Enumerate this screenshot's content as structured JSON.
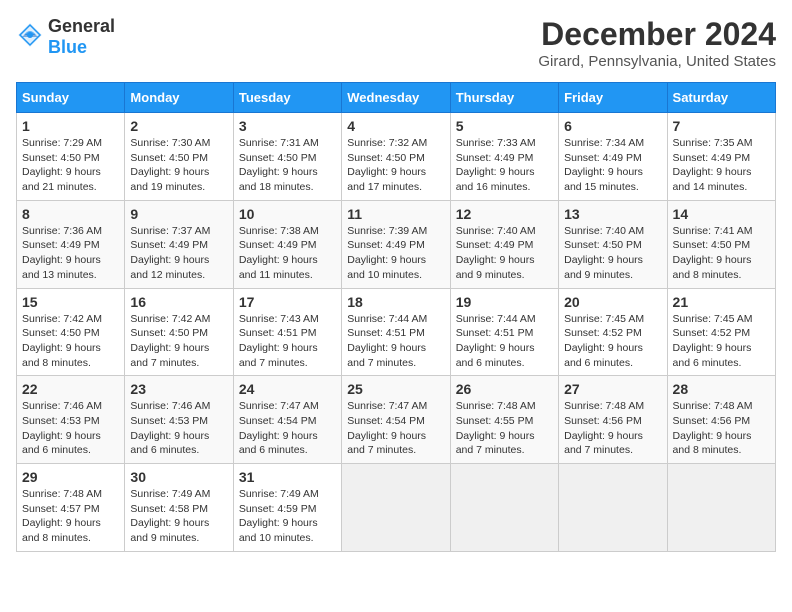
{
  "header": {
    "logo_general": "General",
    "logo_blue": "Blue",
    "title": "December 2024",
    "location": "Girard, Pennsylvania, United States"
  },
  "calendar": {
    "days_of_week": [
      "Sunday",
      "Monday",
      "Tuesday",
      "Wednesday",
      "Thursday",
      "Friday",
      "Saturday"
    ],
    "weeks": [
      [
        {
          "day": "1",
          "sunrise": "7:29 AM",
          "sunset": "4:50 PM",
          "daylight": "9 hours and 21 minutes."
        },
        {
          "day": "2",
          "sunrise": "7:30 AM",
          "sunset": "4:50 PM",
          "daylight": "9 hours and 19 minutes."
        },
        {
          "day": "3",
          "sunrise": "7:31 AM",
          "sunset": "4:50 PM",
          "daylight": "9 hours and 18 minutes."
        },
        {
          "day": "4",
          "sunrise": "7:32 AM",
          "sunset": "4:50 PM",
          "daylight": "9 hours and 17 minutes."
        },
        {
          "day": "5",
          "sunrise": "7:33 AM",
          "sunset": "4:49 PM",
          "daylight": "9 hours and 16 minutes."
        },
        {
          "day": "6",
          "sunrise": "7:34 AM",
          "sunset": "4:49 PM",
          "daylight": "9 hours and 15 minutes."
        },
        {
          "day": "7",
          "sunrise": "7:35 AM",
          "sunset": "4:49 PM",
          "daylight": "9 hours and 14 minutes."
        }
      ],
      [
        {
          "day": "8",
          "sunrise": "7:36 AM",
          "sunset": "4:49 PM",
          "daylight": "9 hours and 13 minutes."
        },
        {
          "day": "9",
          "sunrise": "7:37 AM",
          "sunset": "4:49 PM",
          "daylight": "9 hours and 12 minutes."
        },
        {
          "day": "10",
          "sunrise": "7:38 AM",
          "sunset": "4:49 PM",
          "daylight": "9 hours and 11 minutes."
        },
        {
          "day": "11",
          "sunrise": "7:39 AM",
          "sunset": "4:49 PM",
          "daylight": "9 hours and 10 minutes."
        },
        {
          "day": "12",
          "sunrise": "7:40 AM",
          "sunset": "4:49 PM",
          "daylight": "9 hours and 9 minutes."
        },
        {
          "day": "13",
          "sunrise": "7:40 AM",
          "sunset": "4:50 PM",
          "daylight": "9 hours and 9 minutes."
        },
        {
          "day": "14",
          "sunrise": "7:41 AM",
          "sunset": "4:50 PM",
          "daylight": "9 hours and 8 minutes."
        }
      ],
      [
        {
          "day": "15",
          "sunrise": "7:42 AM",
          "sunset": "4:50 PM",
          "daylight": "9 hours and 8 minutes."
        },
        {
          "day": "16",
          "sunrise": "7:42 AM",
          "sunset": "4:50 PM",
          "daylight": "9 hours and 7 minutes."
        },
        {
          "day": "17",
          "sunrise": "7:43 AM",
          "sunset": "4:51 PM",
          "daylight": "9 hours and 7 minutes."
        },
        {
          "day": "18",
          "sunrise": "7:44 AM",
          "sunset": "4:51 PM",
          "daylight": "9 hours and 7 minutes."
        },
        {
          "day": "19",
          "sunrise": "7:44 AM",
          "sunset": "4:51 PM",
          "daylight": "9 hours and 6 minutes."
        },
        {
          "day": "20",
          "sunrise": "7:45 AM",
          "sunset": "4:52 PM",
          "daylight": "9 hours and 6 minutes."
        },
        {
          "day": "21",
          "sunrise": "7:45 AM",
          "sunset": "4:52 PM",
          "daylight": "9 hours and 6 minutes."
        }
      ],
      [
        {
          "day": "22",
          "sunrise": "7:46 AM",
          "sunset": "4:53 PM",
          "daylight": "9 hours and 6 minutes."
        },
        {
          "day": "23",
          "sunrise": "7:46 AM",
          "sunset": "4:53 PM",
          "daylight": "9 hours and 6 minutes."
        },
        {
          "day": "24",
          "sunrise": "7:47 AM",
          "sunset": "4:54 PM",
          "daylight": "9 hours and 6 minutes."
        },
        {
          "day": "25",
          "sunrise": "7:47 AM",
          "sunset": "4:54 PM",
          "daylight": "9 hours and 7 minutes."
        },
        {
          "day": "26",
          "sunrise": "7:48 AM",
          "sunset": "4:55 PM",
          "daylight": "9 hours and 7 minutes."
        },
        {
          "day": "27",
          "sunrise": "7:48 AM",
          "sunset": "4:56 PM",
          "daylight": "9 hours and 7 minutes."
        },
        {
          "day": "28",
          "sunrise": "7:48 AM",
          "sunset": "4:56 PM",
          "daylight": "9 hours and 8 minutes."
        }
      ],
      [
        {
          "day": "29",
          "sunrise": "7:48 AM",
          "sunset": "4:57 PM",
          "daylight": "9 hours and 8 minutes."
        },
        {
          "day": "30",
          "sunrise": "7:49 AM",
          "sunset": "4:58 PM",
          "daylight": "9 hours and 9 minutes."
        },
        {
          "day": "31",
          "sunrise": "7:49 AM",
          "sunset": "4:59 PM",
          "daylight": "9 hours and 10 minutes."
        },
        null,
        null,
        null,
        null
      ]
    ]
  },
  "labels": {
    "sunrise": "Sunrise:",
    "sunset": "Sunset:",
    "daylight": "Daylight:"
  }
}
